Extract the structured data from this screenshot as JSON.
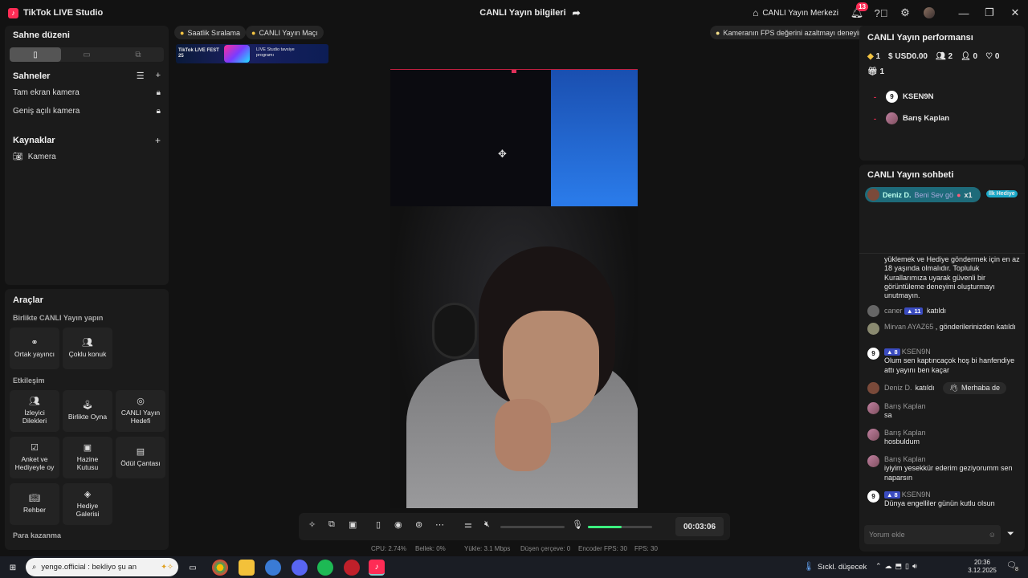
{
  "app": {
    "name": "TikTok LIVE Studio",
    "window_title": "CANLI Yayın bilgileri",
    "live_center": "CANLI Yayın Merkezi",
    "notif_count": "13"
  },
  "left": {
    "scene_layout_title": "Sahne düzeni",
    "scenes_title": "Sahneler",
    "scenes": [
      "Tam ekran kamera",
      "Geniş açılı kamera"
    ],
    "sources_title": "Kaynaklar",
    "sources": [
      "Kamera"
    ],
    "tools_title": "Araçlar",
    "group1": "Birlikte CANLI Yayın yapın",
    "group1_tools": [
      "Ortak yayıncı",
      "Çoklu konuk"
    ],
    "group2": "Etkileşim",
    "group2_tools": [
      "İzleyici Dilekleri",
      "Birlikte Oyna",
      "CANLI Yayın Hedefi",
      "Anket ve Hediyeyle oy",
      "Hazine Kutusu",
      "Ödül Çantası",
      "Rehber",
      "Hediye Galerisi"
    ],
    "group3": "Para kazanma"
  },
  "top": {
    "pill1": "Saatlik Sıralama",
    "pill2": "CANLI Yayın Maçı",
    "fps_tip": "Kameranın FPS değerini azaltmayı deneyin",
    "banner_text1": "TikTok LIVE FEST 25",
    "banner_text2": "LIVE Studio tavsiye programı"
  },
  "controls": {
    "timer": "00:03:06",
    "volume_level": 0.52
  },
  "stats": {
    "cpu": "CPU: 2.74%",
    "mem": "Bellek: 0%",
    "upload": "Yükle: 3.1 Mbps",
    "dropped": "Düşen çerçeve: 0",
    "enc_fps": "Encoder FPS: 30",
    "fps": "FPS: 30"
  },
  "perf": {
    "title": "CANLI Yayın performansı",
    "diamonds": "1",
    "usd": "USD0.00",
    "viewers": "2",
    "follows": "0",
    "likes": "0",
    "gifts": "1",
    "ranking": [
      "KSEN9N",
      "Barış Kaplan"
    ]
  },
  "chat": {
    "title": "CANLI Yayın sohbeti",
    "pinned_user": "Deniz D.",
    "pinned_text": "Beni Sev gö",
    "pinned_count": "x1",
    "pinned_badge": "İlk Hediye",
    "notice": "yüklemek ve Hediye göndermek için en az 18 yaşında olmalıdır. Topluluk Kurallarımıza uyarak güvenli bir görüntüleme deneyimi oluşturmayı unutmayın.",
    "m1_user": "caner",
    "m1_lvl": "11",
    "m1_text": "katıldı",
    "m2_user": "Mirvan",
    "m2_extra": "AYAZ65",
    "m2_text": ", gönderilerinizden katıldı",
    "m3_user": "KSEN9N",
    "m3_lvl": "8",
    "m3_text": "Olum sen kaptıncaçok hoş bi hanfendiye attı yayını ben kaçar",
    "m4_user": "Deniz D.",
    "m4_text": "katıldı",
    "m4_btn": "Merhaba de",
    "m5_user": "Barış Kaplan",
    "m5_text": "sa",
    "m6_user": "Barış Kaplan",
    "m6_text": "hosbuldum",
    "m7_user": "Barış Kaplan",
    "m7_text": "iyiyim yesekkür ederim geziyorumm sen naparsın",
    "m8_user": "KSEN9N",
    "m8_lvl": "8",
    "m8_text": "Dünya engelliler günün kutlu olsun",
    "comment_placeholder": "Yorum ekle"
  },
  "taskbar": {
    "search_text": "yenge.official : bekliyo şu an",
    "weather": "Sıckl. düşecek",
    "time": "20:36",
    "date": "3.12.2025",
    "notif": "8"
  }
}
